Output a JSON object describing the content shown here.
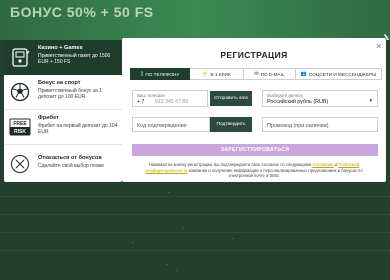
{
  "background": {
    "banner": "БОНУС 50% + 50 FS",
    "chevron": "❯",
    "dots": [
      "·",
      "·",
      "·",
      "·",
      "·",
      "·"
    ]
  },
  "bonuses": [
    {
      "title": "Казино + Games",
      "desc": "Приветственный пакет до 1500 EUR + 150 FS",
      "icon": "casino-icon",
      "active": true
    },
    {
      "title": "Бонус на спорт",
      "desc": "Приветственный бонус за 1 депозит до 100 EUR",
      "icon": "soccer-ball-icon",
      "active": false
    },
    {
      "title": "Фрибет",
      "desc": "Фрибет на первый депозит до 104 EUR",
      "icon": "freebet-icon",
      "icon_text": [
        "FREE",
        "RISK"
      ],
      "active": false
    },
    {
      "title": "Отказаться от бонусов",
      "desc": "Сделайте свой выбор позже",
      "icon": "decline-icon",
      "active": false
    }
  ],
  "modal": {
    "close_label": "×",
    "title": "РЕГИСТРАЦИЯ",
    "tabs": [
      {
        "label": "ПО ТЕЛЕФОНУ",
        "icon": "phone-icon",
        "glyph": "▯",
        "active": true
      },
      {
        "label": "В 1 КЛИК",
        "icon": "lightning-icon",
        "glyph": "⚡",
        "active": false
      },
      {
        "label": "ПО E-MAIL",
        "icon": "envelope-icon",
        "glyph": "✉",
        "active": false
      },
      {
        "label": "СОЦСЕТИ И МЕССЕНДЖЕРЫ",
        "icon": "people-icon",
        "glyph": "👥",
        "active": false
      }
    ],
    "phone": {
      "label": "Ваш телефон",
      "code": "+ 7",
      "placeholder": "912 345 67 89",
      "flag": "flag-icon"
    },
    "send_sms": "Отправить sms",
    "currency": {
      "label": "Выберите валюту",
      "value": "Российский рубль (RUB)"
    },
    "code_placeholder": "Код подтверждения",
    "confirm": "Подтвердить",
    "promo_placeholder": "Промокод (при наличии)",
    "submit": "ЗАРЕГИСТРИРОВАТЬСЯ",
    "legal_before": "Нажимая на кнопку регистрации, вы подтверждаете свое согласие со следующими ",
    "legal_link1": "Условиями",
    "legal_mid": " и ",
    "legal_link2": "Политикой конфиденциальности",
    "legal_after": " компании и получение информации о персонализированных предложениях и бонусах по электронной почте и SMS."
  },
  "colors": {
    "accent_dark": "#1f3d2c",
    "submit": "#c9a6dc",
    "link": "#c8a600",
    "bg": "#1d3a2b"
  }
}
